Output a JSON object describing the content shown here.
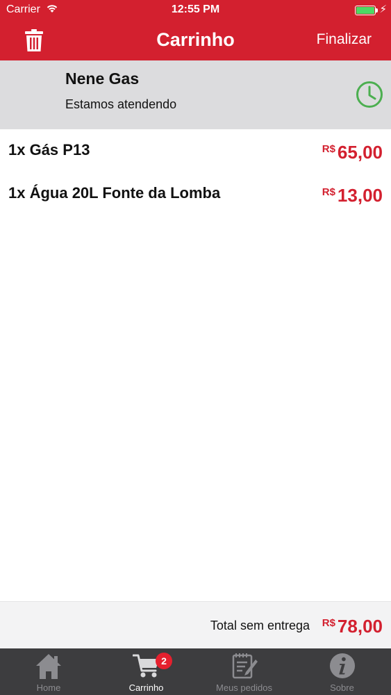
{
  "status_bar": {
    "carrier": "Carrier",
    "time": "12:55 PM",
    "battery_color": "#4cd964"
  },
  "nav": {
    "title": "Carrinho",
    "action": "Finalizar",
    "left_icon": "trash-icon",
    "background": "#d3202f"
  },
  "store": {
    "name": "Nene Gas",
    "status": "Estamos atendendo",
    "status_icon": "clock-icon",
    "status_color": "#4caf50"
  },
  "currency": "R$",
  "items": [
    {
      "description": "1x Gás P13",
      "amount": "65,00"
    },
    {
      "description": "1x Água 20L Fonte da Lomba",
      "amount": "13,00"
    }
  ],
  "total": {
    "label": "Total sem entrega",
    "amount": "78,00"
  },
  "tabs": [
    {
      "label": "Home",
      "icon": "home-icon",
      "active": false
    },
    {
      "label": "Carrinho",
      "icon": "cart-icon",
      "active": true,
      "badge": "2"
    },
    {
      "label": "Meus pedidos",
      "icon": "orders-icon",
      "active": false
    },
    {
      "label": "Sobre",
      "icon": "info-icon",
      "active": false
    }
  ]
}
